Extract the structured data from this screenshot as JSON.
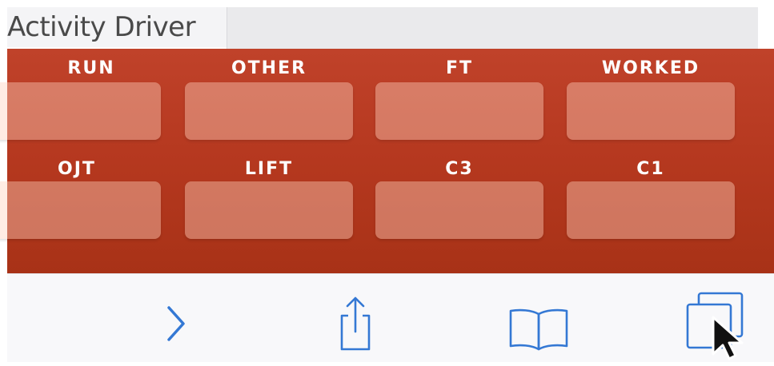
{
  "header": {
    "title": "Activity Driver",
    "input_value": ""
  },
  "grid": {
    "row1": [
      "RUN",
      "OTHER",
      "FT",
      "WORKED"
    ],
    "row2": [
      "OJT",
      "LIFT",
      "C3",
      "C1"
    ],
    "values": [
      "",
      "",
      "",
      "",
      "",
      "",
      "",
      ""
    ]
  },
  "toolbar": {
    "icons": [
      "forward-icon",
      "share-icon",
      "bookmarks-icon",
      "tabs-icon"
    ]
  },
  "colors": {
    "panel": "#b5381f",
    "accent": "#3478d4"
  }
}
